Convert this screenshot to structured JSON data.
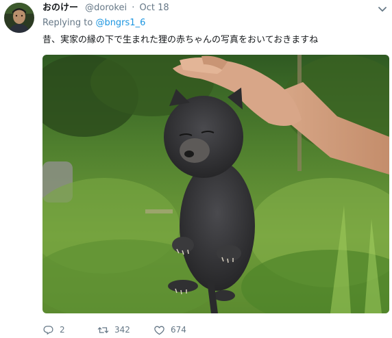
{
  "tweet": {
    "display_name": "おのけー",
    "handle": "@dorokei",
    "separator": "·",
    "date": "Oct 18",
    "replying_prefix": "Replying to",
    "replying_mention": "@bngrs1_6",
    "text": "昔、実家の縁の下で生まれた狸の赤ちゃんの写真をおいておきますね",
    "media_alt": ""
  },
  "actions": {
    "reply_count": "2",
    "retweet_count": "342",
    "like_count": "674"
  },
  "icons": {
    "reply": "reply-icon",
    "retweet": "retweet-icon",
    "like": "heart-icon",
    "menu": "chevron-down-icon"
  },
  "colors": {
    "link": "#1b95e0",
    "muted": "#657786",
    "text": "#14171a"
  }
}
